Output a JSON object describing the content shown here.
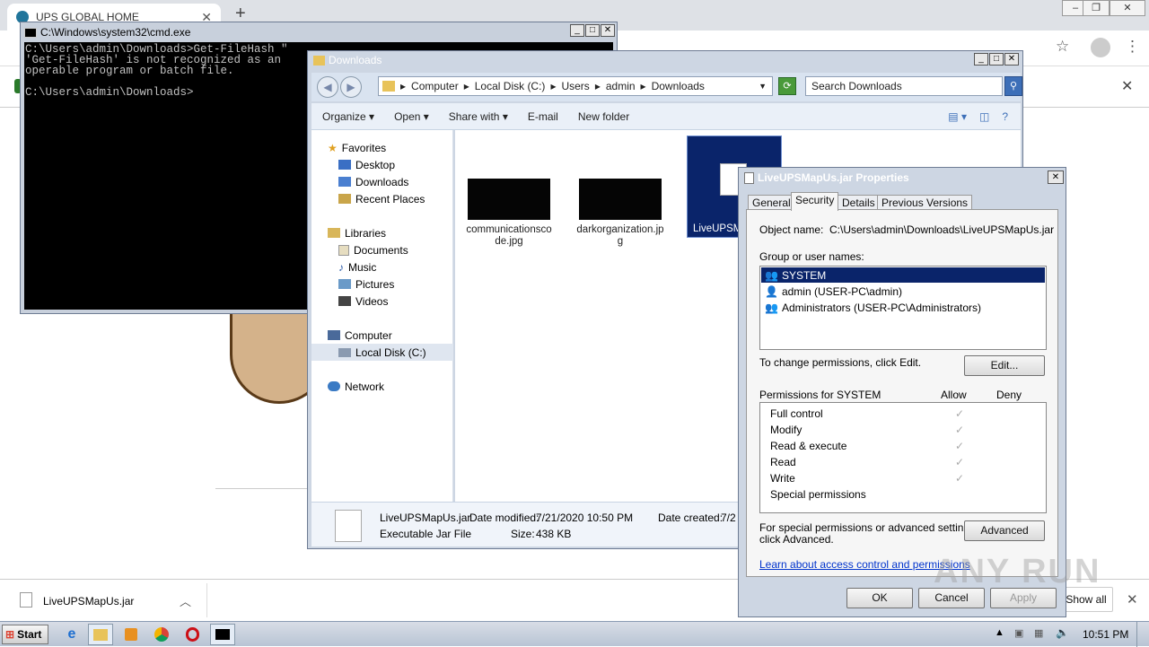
{
  "chrome": {
    "tab_title": "UPS GLOBAL HOME",
    "download_file": "LiveUPSMapUs.jar",
    "show_all": "Show all"
  },
  "cmd": {
    "title": "C:\\Windows\\system32\\cmd.exe",
    "lines": [
      "C:\\Users\\admin\\Downloads>Get-FileHash \"",
      "'Get-FileHash' is not recognized as an",
      "operable program or batch file.",
      "",
      "C:\\Users\\admin\\Downloads>"
    ]
  },
  "explorer": {
    "title": "Downloads",
    "breadcrumb": [
      "Computer",
      "Local Disk (C:)",
      "Users",
      "admin",
      "Downloads"
    ],
    "search_placeholder": "Search Downloads",
    "toolbar": {
      "organize": "Organize",
      "open": "Open",
      "share": "Share with",
      "email": "E-mail",
      "new_folder": "New folder"
    },
    "nav": {
      "favorites": "Favorites",
      "desktop": "Desktop",
      "downloads": "Downloads",
      "recent": "Recent Places",
      "libraries": "Libraries",
      "documents": "Documents",
      "music": "Music",
      "pictures": "Pictures",
      "videos": "Videos",
      "computer": "Computer",
      "local_disk": "Local Disk (C:)",
      "network": "Network"
    },
    "files": [
      {
        "name": "communicationscode.jpg"
      },
      {
        "name": "darkorganization.jpg"
      },
      {
        "name": "LiveUPSM"
      }
    ],
    "details": {
      "name": "LiveUPSMapUs.jar",
      "modified_label": "Date modified:",
      "modified": "7/21/2020 10:50 PM",
      "created_label": "Date created:",
      "created": "7/2",
      "type": "Executable Jar File",
      "size_label": "Size:",
      "size": "438 KB"
    }
  },
  "props": {
    "title": "LiveUPSMapUs.jar Properties",
    "tabs": [
      "General",
      "Security",
      "Details",
      "Previous Versions"
    ],
    "object_label": "Object name:",
    "object_value": "C:\\Users\\admin\\Downloads\\LiveUPSMapUs.jar",
    "group_label": "Group or user names:",
    "users": [
      "SYSTEM",
      "admin (USER-PC\\admin)",
      "Administrators (USER-PC\\Administrators)"
    ],
    "change_text": "To change permissions, click Edit.",
    "edit": "Edit...",
    "perm_for": "Permissions for SYSTEM",
    "allow": "Allow",
    "deny": "Deny",
    "permissions": [
      "Full control",
      "Modify",
      "Read & execute",
      "Read",
      "Write",
      "Special permissions"
    ],
    "special_text_1": "For special permissions or advanced settings,",
    "special_text_2": "click Advanced.",
    "advanced": "Advanced",
    "link": "Learn about access control and permissions",
    "ok": "OK",
    "cancel": "Cancel",
    "apply": "Apply"
  },
  "taskbar": {
    "start": "Start",
    "time": "10:51 PM"
  },
  "watermark": "ANY RUN"
}
